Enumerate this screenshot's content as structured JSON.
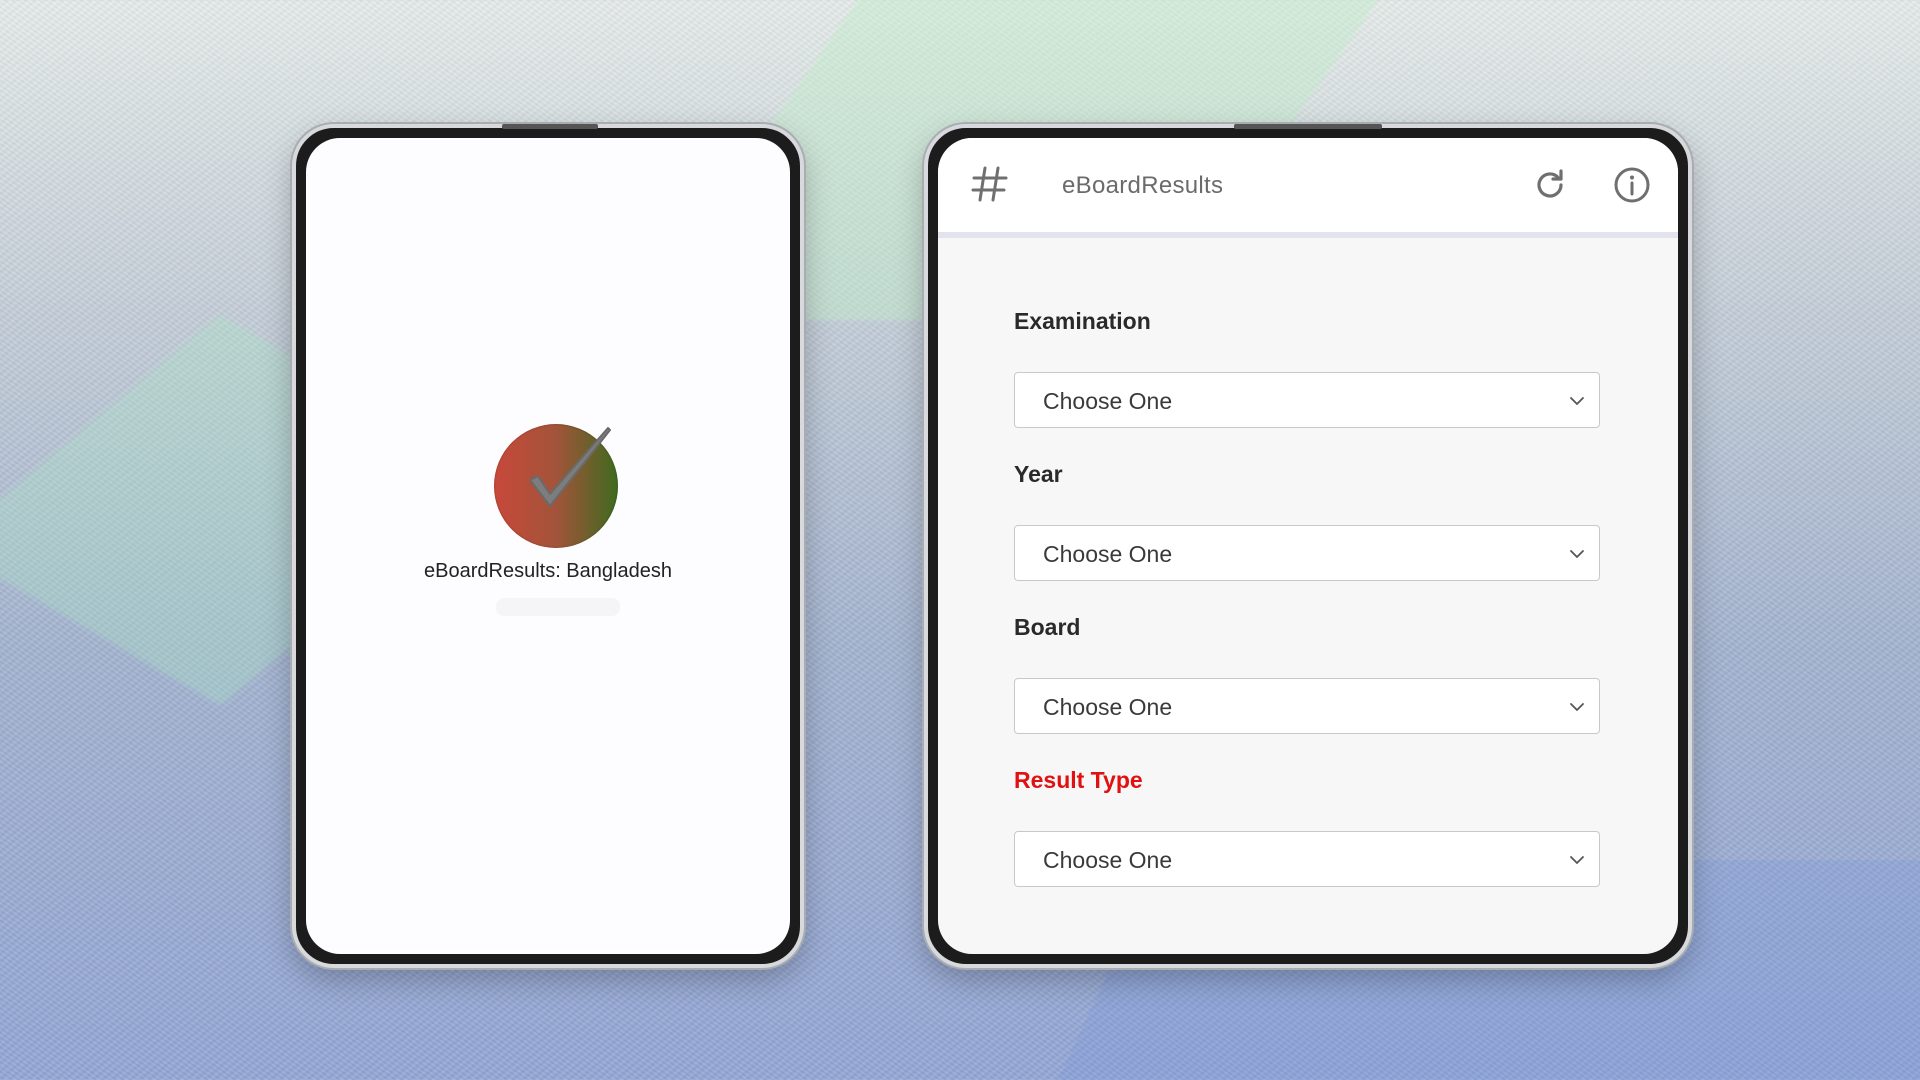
{
  "splash": {
    "app_name": "eBoardResults: Bangladesh",
    "logo": "checkmark-circle-logo"
  },
  "appbar": {
    "menu_icon": "hash-icon",
    "title": "eBoardResults",
    "refresh_icon": "refresh-icon",
    "info_icon": "info-icon"
  },
  "form": {
    "fields": [
      {
        "label": "Examination",
        "value": "Choose One",
        "required": false
      },
      {
        "label": "Year",
        "value": "Choose One",
        "required": false
      },
      {
        "label": "Board",
        "value": "Choose One",
        "required": false
      },
      {
        "label": "Result Type",
        "value": "Choose One",
        "required": true
      }
    ]
  },
  "colors": {
    "required_label": "#e21010",
    "appbar_background": "#ffffff",
    "screen_background": "#f7f7f7"
  }
}
